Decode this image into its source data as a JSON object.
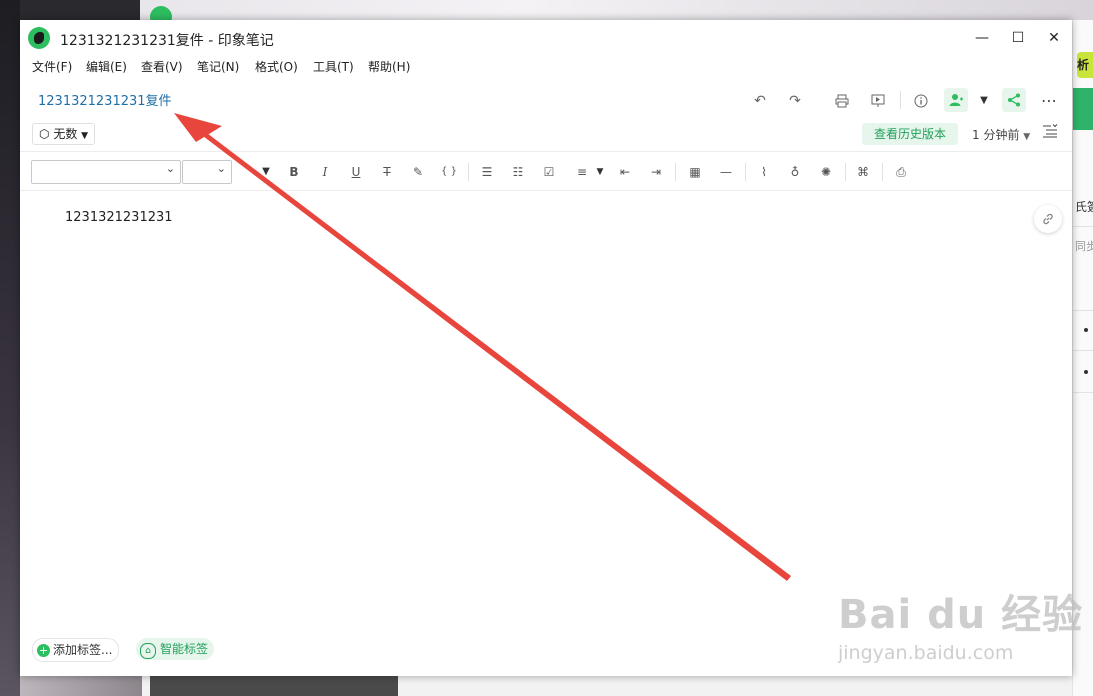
{
  "window": {
    "title": "1231321231231复件 - 印象笔记",
    "controls": {
      "minimize": "—",
      "maximize": "☐",
      "close": "✕"
    }
  },
  "menu": [
    {
      "label": "文件(F)"
    },
    {
      "label": "编辑(E)"
    },
    {
      "label": "查看(V)"
    },
    {
      "label": "笔记(N)"
    },
    {
      "label": "格式(O)"
    },
    {
      "label": "工具(T)"
    },
    {
      "label": "帮助(H)"
    }
  ],
  "note": {
    "title": "1231321231231复件",
    "notebook": "无数",
    "history_button": "查看历史版本",
    "updated": "1 分钟前",
    "body": "1231321231231"
  },
  "format_toolbar": {
    "font_family": "",
    "font_size": ""
  },
  "tags": {
    "add_label": "添加标签...",
    "smart_label": "智能标签"
  },
  "background_panel": {
    "top_right_badge": "析",
    "row1": "氏簽",
    "row2": "同步"
  },
  "watermark": {
    "brand": "Bai du 经验",
    "url": "jingyan.baidu.com"
  },
  "colors": {
    "accent_green": "#2dbe60",
    "title_link_blue": "#1f6fa8",
    "annotation_arrow": "#e8453c"
  },
  "icons": {
    "undo": "undo-icon",
    "redo": "redo-icon",
    "print": "print-icon",
    "present": "presentation-icon",
    "info": "info-icon",
    "share_user": "add-user-icon",
    "share": "share-icon",
    "more": "more-icon"
  }
}
